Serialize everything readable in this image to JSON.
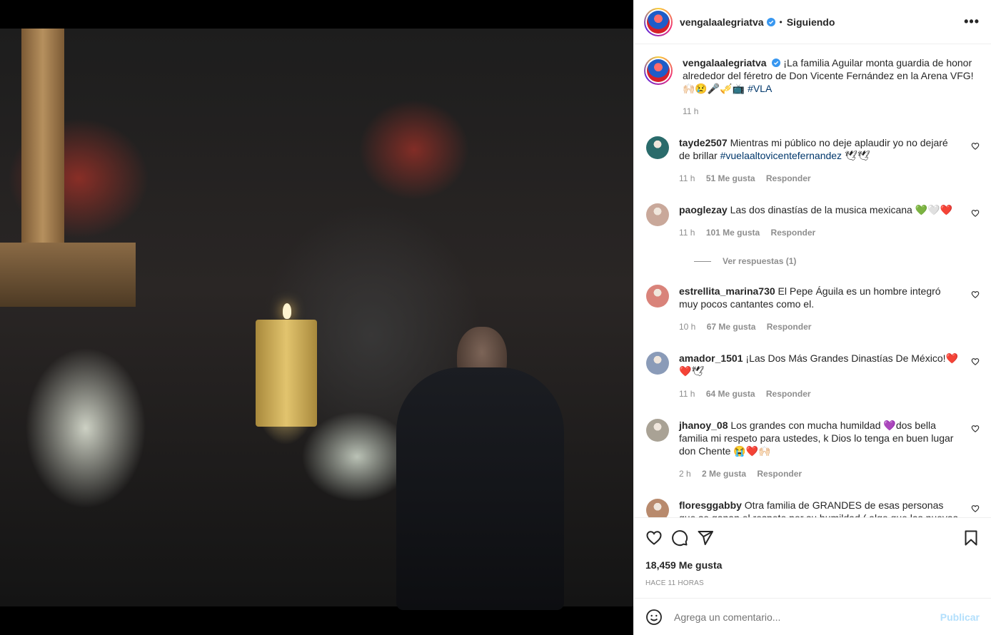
{
  "header": {
    "username": "vengalaalegriatva",
    "separator": "•",
    "follow_status": "Siguiendo",
    "more_label": "•••"
  },
  "caption": {
    "username": "vengalaalegriatva",
    "text": "¡La familia Aguilar monta guardia de honor alrededor del féretro de Don Vicente Fernández en la Arena VFG! 🙌🏻😢🎤🎺📺",
    "hashtag": "#VLA",
    "time": "11 h"
  },
  "comments": [
    {
      "username": "tayde2507",
      "text": "Mientras mi público no deje aplaudir yo no dejaré de brillar",
      "hashtag": "#vuelaaltovicentefernandez",
      "emoji": " 🕊🕊",
      "time": "11 h",
      "likes": "51 Me gusta",
      "reply": "Responder",
      "avatar_color": "#2a6b6b"
    },
    {
      "username": "paoglezay",
      "text": "Las dos dinastías de la musica mexicana 💚🤍❤️",
      "hashtag": "",
      "emoji": "",
      "time": "11 h",
      "likes": "101 Me gusta",
      "reply": "Responder",
      "avatar_color": "#c9a89a"
    },
    {
      "username": "estrellita_marina730",
      "text": "El Pepe Águila es un hombre integró muy pocos cantantes como el.",
      "hashtag": "",
      "emoji": "",
      "time": "10 h",
      "likes": "67 Me gusta",
      "reply": "Responder",
      "avatar_color": "#d9837a"
    },
    {
      "username": "amador_1501",
      "text": "¡Las Dos Más Grandes Dinastías De México!❤️❤️🕊",
      "hashtag": "",
      "emoji": "",
      "time": "11 h",
      "likes": "64 Me gusta",
      "reply": "Responder",
      "avatar_color": "#8a9bb8"
    },
    {
      "username": "jhanoy_08",
      "text": "Los grandes con mucha humildad 💜dos bella familia mi respeto para ustedes, k Dios lo tenga en buen lugar don Chente 😭❤️🙌🏻",
      "hashtag": "",
      "emoji": "",
      "time": "2 h",
      "likes": "2 Me gusta",
      "reply": "Responder",
      "avatar_color": "#a9a295"
    },
    {
      "username": "floresggabby",
      "text": "Otra familia de GRANDES de esas personas que se ganan el respeto por su humildad ( algo que las nuevas \"estrellaras\" tendrían que aprender) no solo es llegar ay que",
      "hashtag": "",
      "emoji": "",
      "time": "",
      "likes": "",
      "reply": "",
      "avatar_color": "#b88a6d"
    }
  ],
  "thread_label": "Ver respuestas (1)",
  "actions": {
    "likes_count": "18,459 Me gusta",
    "time_ago": "HACE 11 HORAS"
  },
  "add_comment": {
    "placeholder": "Agrega un comentario...",
    "post_label": "Publicar"
  },
  "colors": {
    "link": "#00376b",
    "muted": "#8e8e8e",
    "verified": "#3897f0",
    "post_disabled": "#b2dffc"
  }
}
